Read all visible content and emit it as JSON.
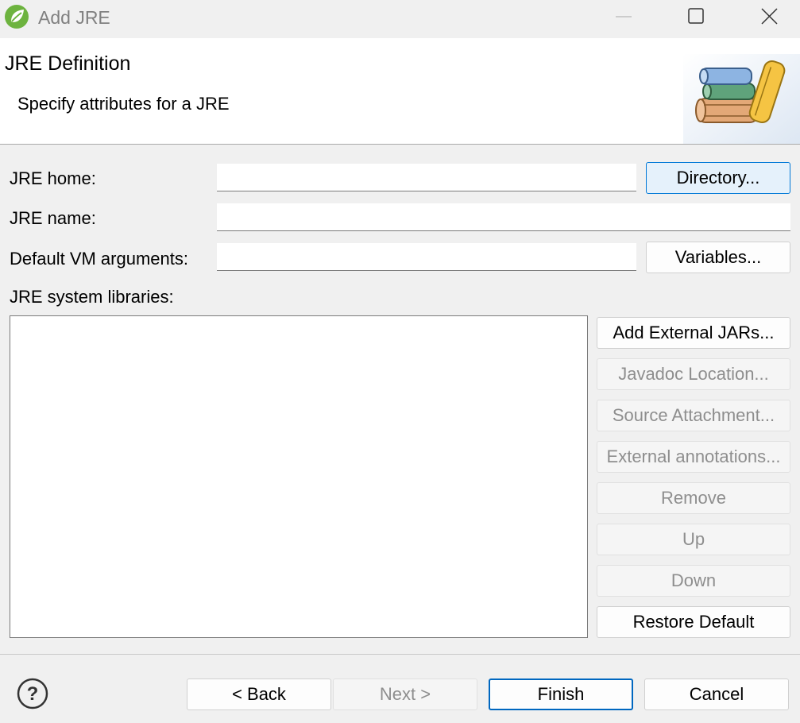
{
  "window": {
    "title": "Add JRE"
  },
  "header": {
    "title": "JRE Definition",
    "description": "Specify attributes for a JRE"
  },
  "form": {
    "jre_home_label": "JRE home:",
    "jre_home_value": "",
    "jre_name_label": "JRE name:",
    "jre_name_value": "",
    "vm_args_label": "Default VM arguments:",
    "vm_args_value": "",
    "directory_button": "Directory...",
    "variables_button": "Variables...",
    "libraries_label": "JRE system libraries:"
  },
  "library_buttons": [
    {
      "label": "Add External JARs...",
      "enabled": true
    },
    {
      "label": "Javadoc Location...",
      "enabled": false
    },
    {
      "label": "Source Attachment...",
      "enabled": false
    },
    {
      "label": "External annotations...",
      "enabled": false
    },
    {
      "label": "Remove",
      "enabled": false
    },
    {
      "label": "Up",
      "enabled": false
    },
    {
      "label": "Down",
      "enabled": false
    },
    {
      "label": "Restore Default",
      "enabled": true
    }
  ],
  "footer": {
    "back": "< Back",
    "next": "Next >",
    "finish": "Finish",
    "cancel": "Cancel"
  },
  "colors": {
    "accent": "#0078d7",
    "app_icon": "#6db33f"
  },
  "icons": {
    "app": "spring-leaf-icon",
    "banner": "books-icon",
    "help": "help-icon"
  }
}
